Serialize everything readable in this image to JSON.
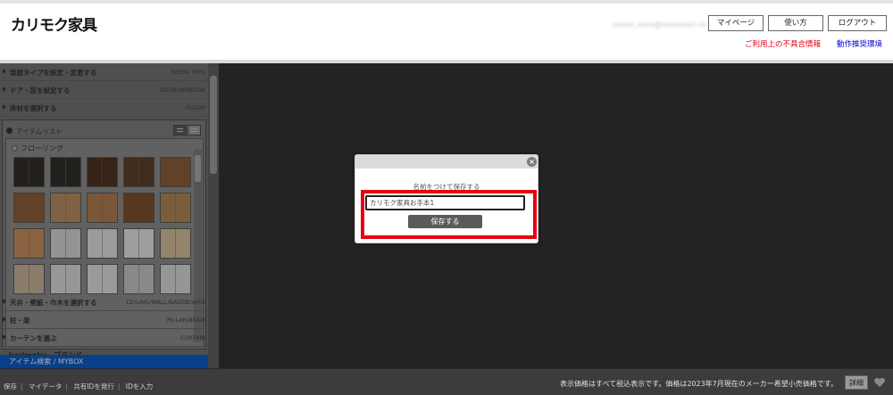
{
  "header": {
    "logo": "カリモク家具",
    "email": "xxxxx_xxxx@xxxxxxxx.co.jp",
    "buttons": [
      "マイページ",
      "使い方",
      "ログアウト"
    ],
    "link_red": "ご利用上の不具合情報",
    "link_blue": "動作推奨環境"
  },
  "left": {
    "menus_top": [
      {
        "jp": "部屋タイプを設定・変更する",
        "en": "ROOM TYPE"
      },
      {
        "jp": "ドア・窓を設定する",
        "en": "DOOR/WINDOW"
      },
      {
        "jp": "床材を選択する",
        "en": "FLOOR"
      }
    ],
    "item_list_title": "アイテムリスト",
    "floor_title": "フローリング",
    "menus_bottom": [
      {
        "jp": "天井・壁紙・巾木を選択する",
        "en": "CEILING/WALL/BASEBOARD"
      },
      {
        "jp": "柱・梁",
        "en": "PILLAR/BEAM"
      },
      {
        "jp": "カーテンを選ぶ",
        "en": "CURTAIN"
      }
    ],
    "brand_row": "karimoku　ブランド",
    "bottom_bar": "アイテム検索 / MYBOX"
  },
  "dialog": {
    "label": "名前をつけて保存する",
    "input_value": "カリモク家具お手本1",
    "save_button": "保存する",
    "close_icon": "×"
  },
  "footer": {
    "links": [
      "保存",
      "マイデータ",
      "共有IDを発行",
      "IDを入力"
    ],
    "note": "表示価格はすべて税込表示です。価格は2023年7月現在のメーカー希望小売価格です。",
    "detail_button": "詳細"
  },
  "tiles": [
    [
      "#2b2620",
      "#2a2723",
      "#4a2c1a",
      "#5a3a22",
      "#8a5a34"
    ],
    [
      "#8d5a30",
      "#b98d5c",
      "#b27c4a",
      "#7c4a22",
      "#b48450"
    ],
    [
      "#c99058",
      "#d9d9d9",
      "#e3e3e3",
      "#e8e8e8",
      "#d9c09b"
    ],
    [
      "#c9b49a",
      "#dedede",
      "#e2e2e2",
      "#c8c8c8",
      "#dcdcdc"
    ]
  ]
}
